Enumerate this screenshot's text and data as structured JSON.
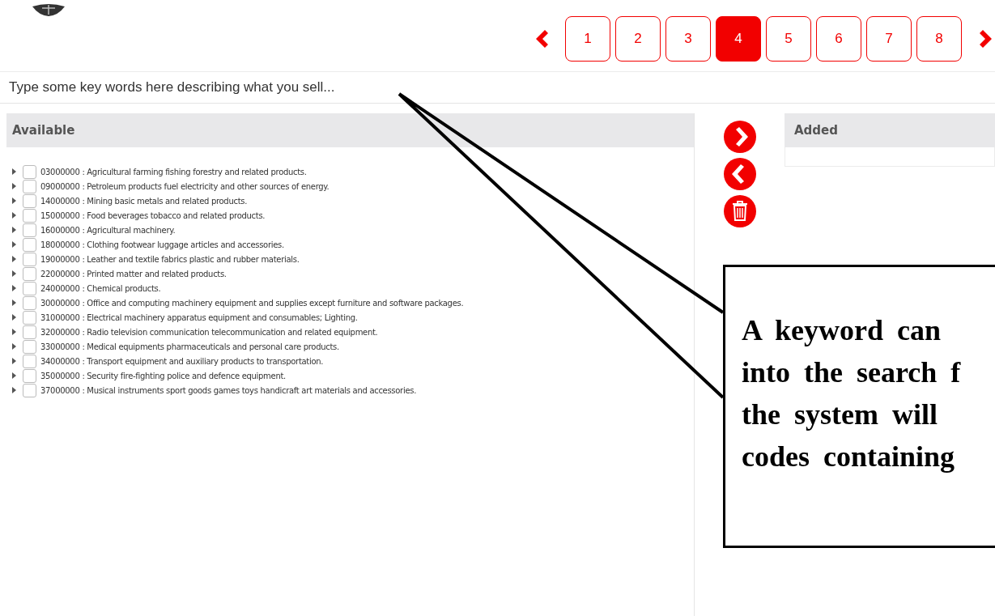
{
  "pagination": {
    "pages": [
      {
        "label": "1",
        "selected": false
      },
      {
        "label": "2",
        "selected": false
      },
      {
        "label": "3",
        "selected": false
      },
      {
        "label": "4",
        "selected": true
      },
      {
        "label": "5",
        "selected": false
      },
      {
        "label": "6",
        "selected": false
      },
      {
        "label": "7",
        "selected": false
      },
      {
        "label": "8",
        "selected": false
      }
    ]
  },
  "search": {
    "placeholder": "Type some key words here describing what you sell..."
  },
  "available": {
    "title": "Available",
    "items": [
      {
        "label": "03000000 : Agricultural farming fishing forestry and related products.",
        "checked": false
      },
      {
        "label": "09000000 : Petroleum products fuel electricity and other sources of energy.",
        "checked": false
      },
      {
        "label": "14000000 : Mining basic metals and related products.",
        "checked": false
      },
      {
        "label": "15000000 : Food beverages tobacco and related products.",
        "checked": false
      },
      {
        "label": "16000000 : Agricultural machinery.",
        "checked": false
      },
      {
        "label": "18000000 : Clothing footwear luggage articles and accessories.",
        "checked": false
      },
      {
        "label": "19000000 : Leather and textile fabrics plastic and rubber materials.",
        "checked": false
      },
      {
        "label": "22000000 : Printed matter and related products.",
        "checked": false
      },
      {
        "label": "24000000 : Chemical products.",
        "checked": false
      },
      {
        "label": "30000000 : Office and computing machinery equipment and supplies except furniture and software packages.",
        "checked": false
      },
      {
        "label": "31000000 : Electrical machinery apparatus equipment and consumables; Lighting.",
        "checked": false
      },
      {
        "label": "32000000 : Radio television communication telecommunication and related equipment.",
        "checked": false
      },
      {
        "label": "33000000 : Medical equipments pharmaceuticals and personal care products.",
        "checked": false
      },
      {
        "label": "34000000 : Transport equipment and auxiliary products to transportation.",
        "checked": false
      },
      {
        "label": "35000000 : Security fire-fighting police and defence equipment.",
        "checked": false
      },
      {
        "label": "37000000 : Musical instruments sport goods games toys handicraft art materials and accessories.",
        "checked": false
      }
    ]
  },
  "added": {
    "title": "Added"
  },
  "callout": {
    "lines": [
      "A keyword can",
      "into the search f",
      "the system will",
      "codes containing"
    ]
  }
}
